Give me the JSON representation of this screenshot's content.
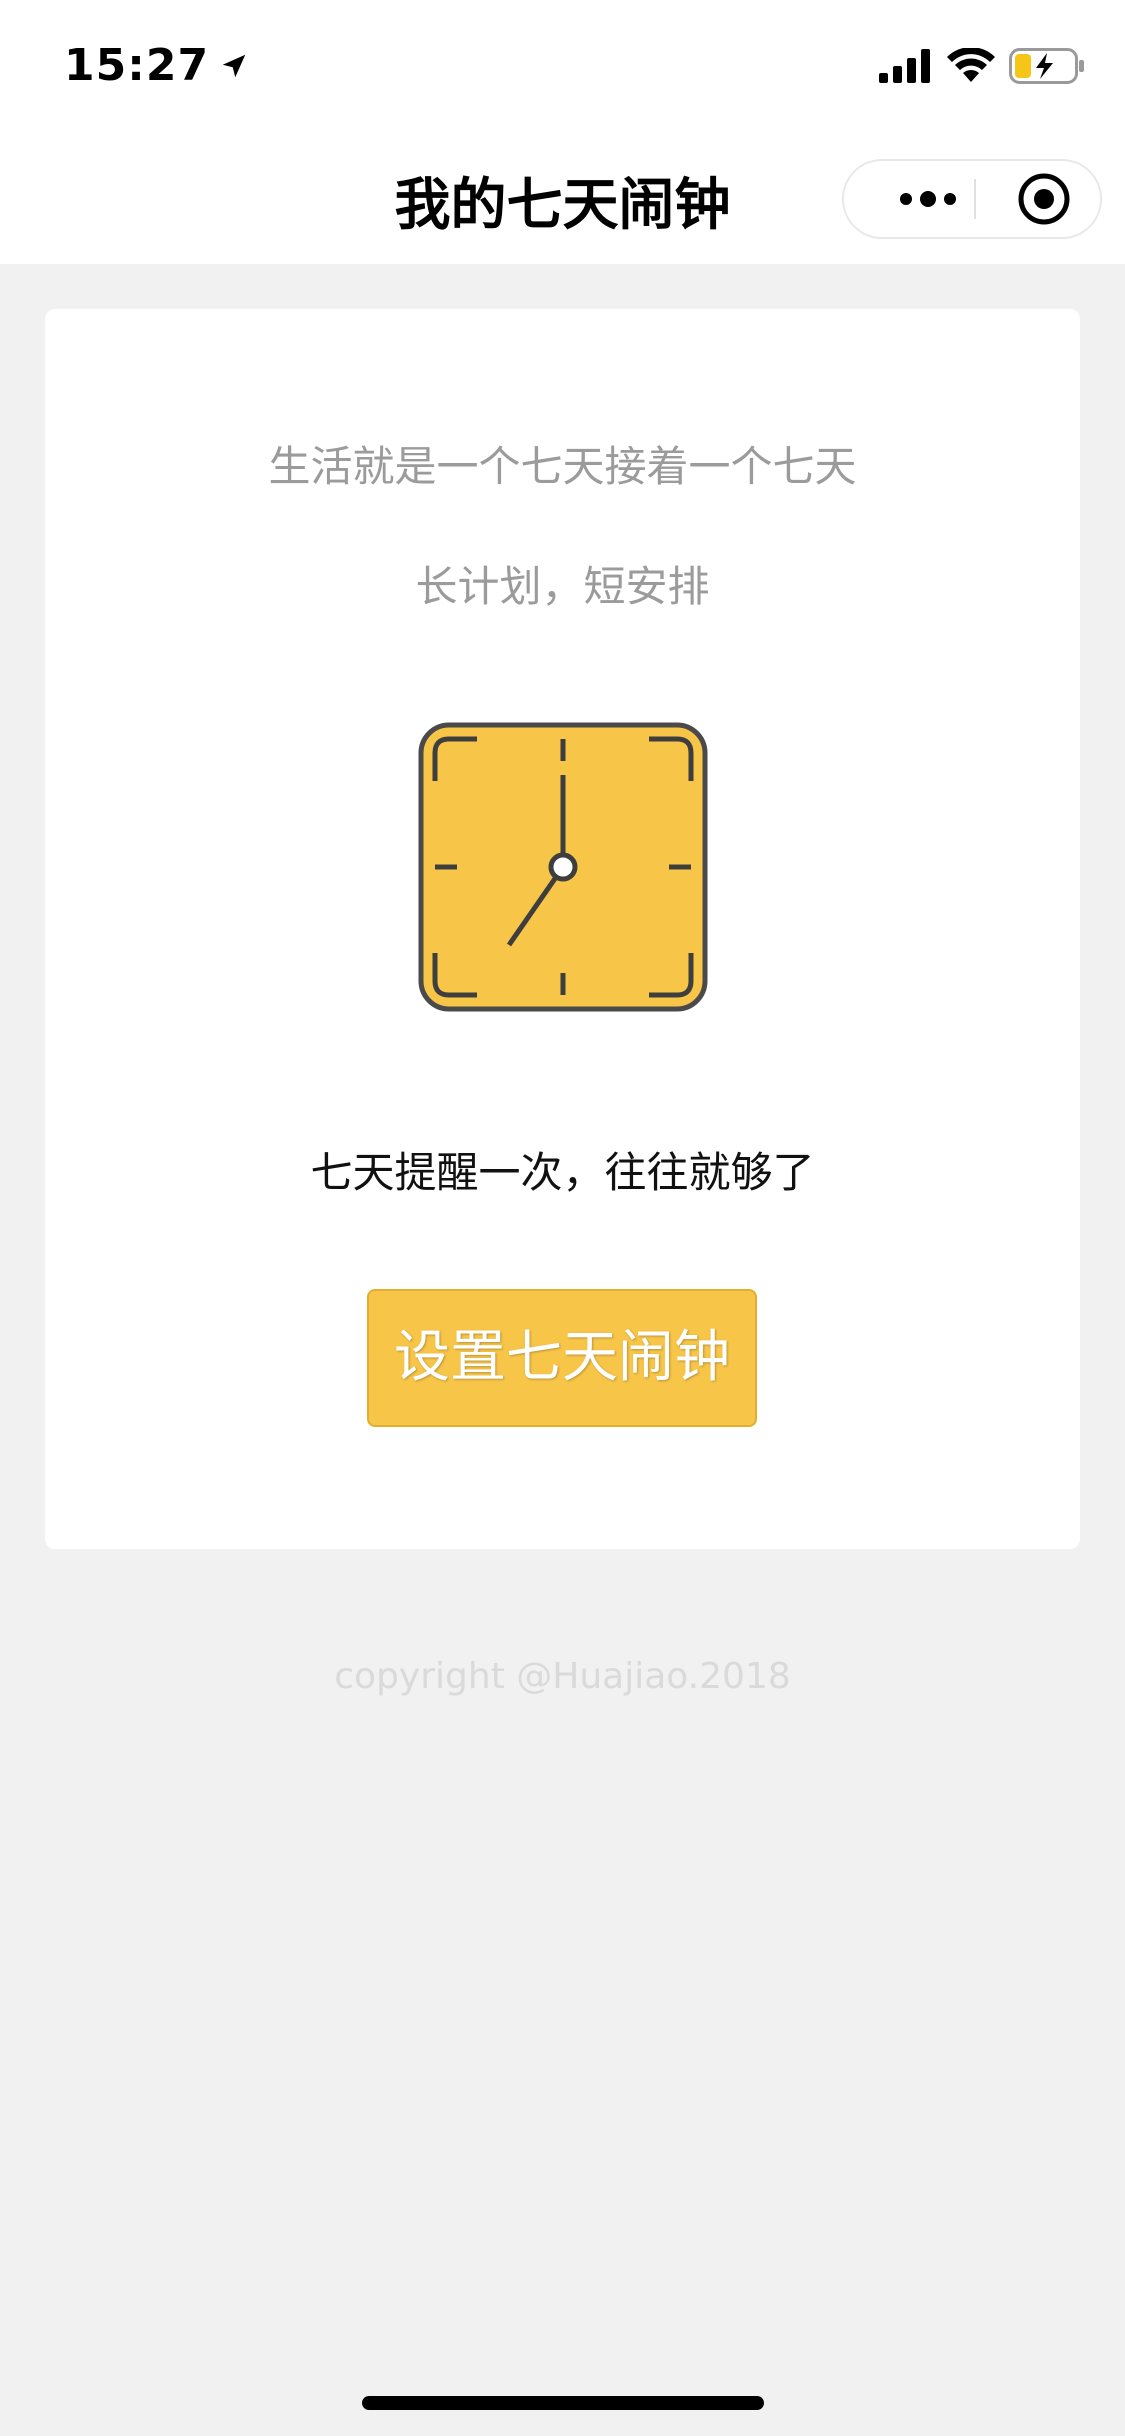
{
  "status_bar": {
    "time": "15:27"
  },
  "nav": {
    "title": "我的七天闹钟"
  },
  "card": {
    "line1": "生活就是一个七天接着一个七天",
    "line2": "长计划，短安排",
    "clock_icon": "clock-icon",
    "reminder_text": "七天提醒一次，往往就够了",
    "button_label": "设置七天闹钟"
  },
  "footer": {
    "copyright": "copyright @Huajiao.2018"
  },
  "colors": {
    "accent": "#f7c548",
    "background": "#f1f1f1",
    "muted_text": "#9b9b9b"
  }
}
